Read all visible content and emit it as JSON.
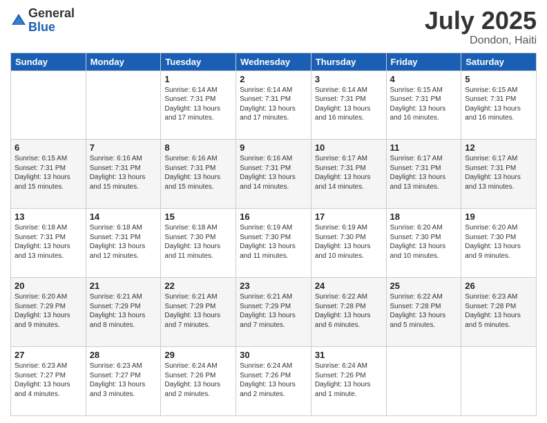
{
  "logo": {
    "general": "General",
    "blue": "Blue"
  },
  "title": "July 2025",
  "location": "Dondon, Haiti",
  "days_of_week": [
    "Sunday",
    "Monday",
    "Tuesday",
    "Wednesday",
    "Thursday",
    "Friday",
    "Saturday"
  ],
  "weeks": [
    [
      {
        "day": "",
        "info": ""
      },
      {
        "day": "",
        "info": ""
      },
      {
        "day": "1",
        "info": "Sunrise: 6:14 AM\nSunset: 7:31 PM\nDaylight: 13 hours\nand 17 minutes."
      },
      {
        "day": "2",
        "info": "Sunrise: 6:14 AM\nSunset: 7:31 PM\nDaylight: 13 hours\nand 17 minutes."
      },
      {
        "day": "3",
        "info": "Sunrise: 6:14 AM\nSunset: 7:31 PM\nDaylight: 13 hours\nand 16 minutes."
      },
      {
        "day": "4",
        "info": "Sunrise: 6:15 AM\nSunset: 7:31 PM\nDaylight: 13 hours\nand 16 minutes."
      },
      {
        "day": "5",
        "info": "Sunrise: 6:15 AM\nSunset: 7:31 PM\nDaylight: 13 hours\nand 16 minutes."
      }
    ],
    [
      {
        "day": "6",
        "info": "Sunrise: 6:15 AM\nSunset: 7:31 PM\nDaylight: 13 hours\nand 15 minutes."
      },
      {
        "day": "7",
        "info": "Sunrise: 6:16 AM\nSunset: 7:31 PM\nDaylight: 13 hours\nand 15 minutes."
      },
      {
        "day": "8",
        "info": "Sunrise: 6:16 AM\nSunset: 7:31 PM\nDaylight: 13 hours\nand 15 minutes."
      },
      {
        "day": "9",
        "info": "Sunrise: 6:16 AM\nSunset: 7:31 PM\nDaylight: 13 hours\nand 14 minutes."
      },
      {
        "day": "10",
        "info": "Sunrise: 6:17 AM\nSunset: 7:31 PM\nDaylight: 13 hours\nand 14 minutes."
      },
      {
        "day": "11",
        "info": "Sunrise: 6:17 AM\nSunset: 7:31 PM\nDaylight: 13 hours\nand 13 minutes."
      },
      {
        "day": "12",
        "info": "Sunrise: 6:17 AM\nSunset: 7:31 PM\nDaylight: 13 hours\nand 13 minutes."
      }
    ],
    [
      {
        "day": "13",
        "info": "Sunrise: 6:18 AM\nSunset: 7:31 PM\nDaylight: 13 hours\nand 13 minutes."
      },
      {
        "day": "14",
        "info": "Sunrise: 6:18 AM\nSunset: 7:31 PM\nDaylight: 13 hours\nand 12 minutes."
      },
      {
        "day": "15",
        "info": "Sunrise: 6:18 AM\nSunset: 7:30 PM\nDaylight: 13 hours\nand 11 minutes."
      },
      {
        "day": "16",
        "info": "Sunrise: 6:19 AM\nSunset: 7:30 PM\nDaylight: 13 hours\nand 11 minutes."
      },
      {
        "day": "17",
        "info": "Sunrise: 6:19 AM\nSunset: 7:30 PM\nDaylight: 13 hours\nand 10 minutes."
      },
      {
        "day": "18",
        "info": "Sunrise: 6:20 AM\nSunset: 7:30 PM\nDaylight: 13 hours\nand 10 minutes."
      },
      {
        "day": "19",
        "info": "Sunrise: 6:20 AM\nSunset: 7:30 PM\nDaylight: 13 hours\nand 9 minutes."
      }
    ],
    [
      {
        "day": "20",
        "info": "Sunrise: 6:20 AM\nSunset: 7:29 PM\nDaylight: 13 hours\nand 9 minutes."
      },
      {
        "day": "21",
        "info": "Sunrise: 6:21 AM\nSunset: 7:29 PM\nDaylight: 13 hours\nand 8 minutes."
      },
      {
        "day": "22",
        "info": "Sunrise: 6:21 AM\nSunset: 7:29 PM\nDaylight: 13 hours\nand 7 minutes."
      },
      {
        "day": "23",
        "info": "Sunrise: 6:21 AM\nSunset: 7:29 PM\nDaylight: 13 hours\nand 7 minutes."
      },
      {
        "day": "24",
        "info": "Sunrise: 6:22 AM\nSunset: 7:28 PM\nDaylight: 13 hours\nand 6 minutes."
      },
      {
        "day": "25",
        "info": "Sunrise: 6:22 AM\nSunset: 7:28 PM\nDaylight: 13 hours\nand 5 minutes."
      },
      {
        "day": "26",
        "info": "Sunrise: 6:23 AM\nSunset: 7:28 PM\nDaylight: 13 hours\nand 5 minutes."
      }
    ],
    [
      {
        "day": "27",
        "info": "Sunrise: 6:23 AM\nSunset: 7:27 PM\nDaylight: 13 hours\nand 4 minutes."
      },
      {
        "day": "28",
        "info": "Sunrise: 6:23 AM\nSunset: 7:27 PM\nDaylight: 13 hours\nand 3 minutes."
      },
      {
        "day": "29",
        "info": "Sunrise: 6:24 AM\nSunset: 7:26 PM\nDaylight: 13 hours\nand 2 minutes."
      },
      {
        "day": "30",
        "info": "Sunrise: 6:24 AM\nSunset: 7:26 PM\nDaylight: 13 hours\nand 2 minutes."
      },
      {
        "day": "31",
        "info": "Sunrise: 6:24 AM\nSunset: 7:26 PM\nDaylight: 13 hours\nand 1 minute."
      },
      {
        "day": "",
        "info": ""
      },
      {
        "day": "",
        "info": ""
      }
    ]
  ]
}
